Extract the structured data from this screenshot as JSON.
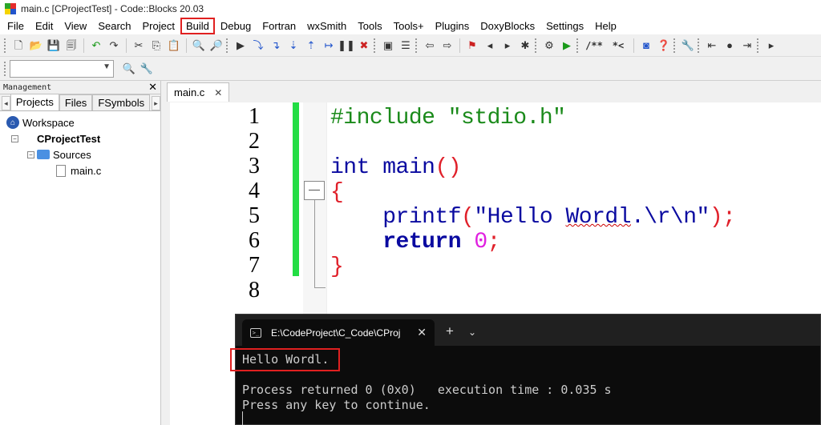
{
  "window": {
    "title": "main.c [CProjectTest] - Code::Blocks 20.03"
  },
  "menu": {
    "items": [
      "File",
      "Edit",
      "View",
      "Search",
      "Project",
      "Build",
      "Debug",
      "Fortran",
      "wxSmith",
      "Tools",
      "Tools+",
      "Plugins",
      "DoxyBlocks",
      "Settings",
      "Help"
    ],
    "highlighted": "Build",
    "highlight_color": "#e02020"
  },
  "toolbar": {
    "doc_comment_label": "/**",
    "line_comment_label": "*<",
    "target_combo_value": ""
  },
  "management": {
    "title": "Management",
    "tabs": [
      "Projects",
      "Files",
      "FSymbols"
    ],
    "active_tab": "Projects",
    "tree": {
      "workspace": "Workspace",
      "project": "CProjectTest",
      "folder": "Sources",
      "file": "main.c"
    }
  },
  "editor": {
    "tab_label": "main.c",
    "line_numbers": [
      "1",
      "2",
      "3",
      "4",
      "5",
      "6",
      "7",
      "8"
    ],
    "code": {
      "line1": "#include \"stdio.h\"",
      "line3_kw": "int",
      "line3_fn": " main",
      "line3_paren": "()",
      "line4": "{",
      "line5_indent": "    ",
      "line5_fn": "printf",
      "line5_open": "(",
      "line5_str_a": "\"Hello ",
      "line5_str_b": "Wordl",
      "line5_str_c": ".\\r\\n\"",
      "line5_close": ");",
      "line6_indent": "    ",
      "line6_kw": "return",
      "line6_num": " 0",
      "line6_semi": ";",
      "line7": "}"
    },
    "change_bar_color": "#22dd44"
  },
  "terminal": {
    "tab_title": "E:\\CodeProject\\C_Code\\CProj",
    "output": {
      "line1": "Hello Wordl.",
      "line3": "Process returned 0 (0x0)   execution time : 0.035 s",
      "line4": "Press any key to continue."
    },
    "highlight_color": "#e02020"
  }
}
